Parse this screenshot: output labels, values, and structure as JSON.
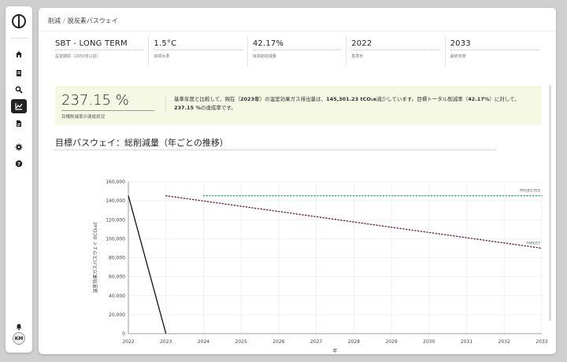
{
  "breadcrumb": {
    "parent": "削減",
    "current": "脱炭素パスウェイ"
  },
  "stats": [
    {
      "value": "SBT - LONG TERM",
      "label": "設定期間（2050年以前）"
    },
    {
      "value": "1.5°C",
      "label": "目標水準"
    },
    {
      "value": "42.17%",
      "label": "目標総削減量"
    },
    {
      "value": "2022",
      "label": "基準年"
    },
    {
      "value": "2033",
      "label": "最終年度"
    }
  ],
  "summary": {
    "big_value": "237.15 %",
    "big_label": "目標削減率の達成状況",
    "text_1": "基準年度と比較して、現在（",
    "year": "2023年",
    "text_2": "）の温室効果ガス排出量は、",
    "reduction": "145,301.23 tCO₂e",
    "text_3": "減少しています。目標トータル削減率（",
    "target_rate": "42.17%",
    "text_4": "）に対して、",
    "achievement": "237.15 %",
    "text_5": "の達成率です。"
  },
  "chart_title": "目標パスウェイ：総削減量（年ごとの推移）",
  "user": {
    "initials": "KM"
  },
  "nav_icons": [
    "home-icon",
    "document-icon",
    "search-icon",
    "chart-icon",
    "report-icon",
    "settings-icon",
    "help-icon"
  ],
  "chart_data": {
    "type": "line",
    "xlabel": "年",
    "ylabel": "温室効果ガスパスウェイ (tCO₂e)",
    "x": [
      2022,
      2023,
      2024,
      2025,
      2026,
      2027,
      2028,
      2029,
      2030,
      2031,
      2032,
      2033
    ],
    "ylim": [
      0,
      160000
    ],
    "yticks": [
      0,
      20000,
      40000,
      60000,
      80000,
      100000,
      120000,
      140000,
      160000
    ],
    "series": [
      {
        "name": "",
        "style": "solid",
        "color": "#111111",
        "points": [
          [
            2022,
            145300
          ],
          [
            2023,
            0
          ]
        ]
      },
      {
        "name": "PROJECTED",
        "style": "dotted",
        "color": "#3aa374",
        "points": [
          [
            2024,
            145300
          ],
          [
            2033,
            145300
          ]
        ]
      },
      {
        "name": "TARGET",
        "style": "dotted",
        "color": "#6b2048",
        "points": [
          [
            2023,
            145300
          ],
          [
            2033,
            90000
          ]
        ]
      }
    ]
  }
}
